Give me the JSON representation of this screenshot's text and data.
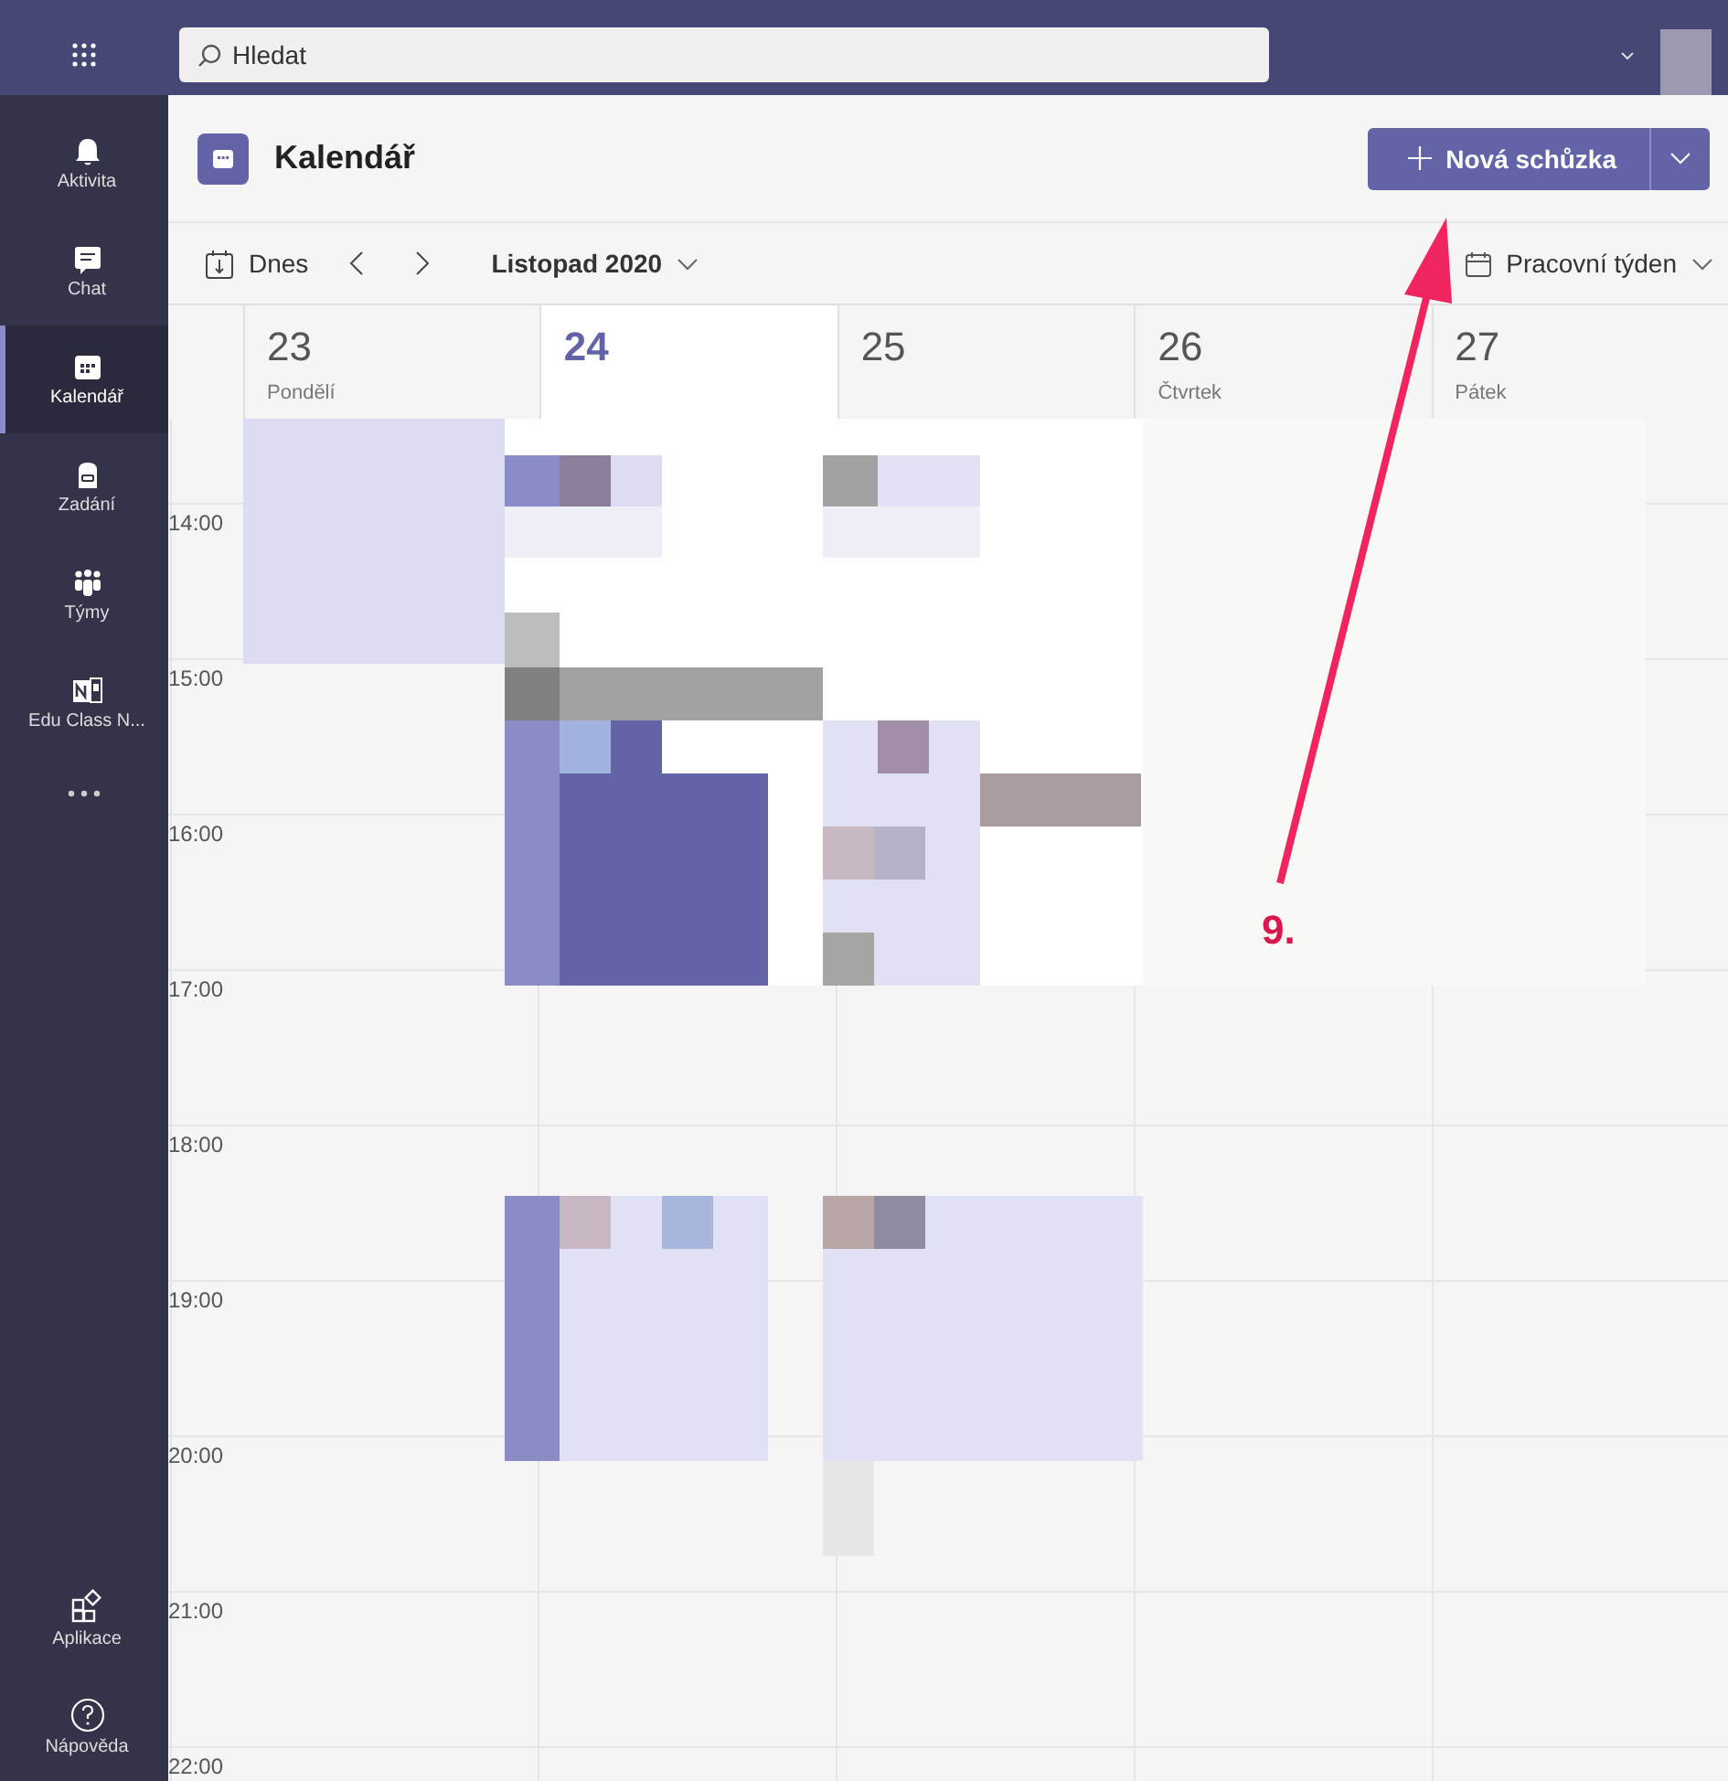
{
  "search": {
    "placeholder": "Hledat"
  },
  "rail": {
    "items": [
      {
        "label": "Aktivita",
        "kind": "bell",
        "selected": false
      },
      {
        "label": "Chat",
        "kind": "chat",
        "selected": false
      },
      {
        "label": "Kalendář",
        "kind": "calendar",
        "selected": true
      },
      {
        "label": "Zadání",
        "kind": "bag",
        "selected": false
      },
      {
        "label": "Týmy",
        "kind": "teams",
        "selected": false
      },
      {
        "label": "Edu Class N...",
        "kind": "notebook",
        "selected": false
      }
    ],
    "bottom": [
      {
        "label": "Aplikace",
        "kind": "apps"
      },
      {
        "label": "Nápověda",
        "kind": "help"
      }
    ]
  },
  "header": {
    "title": "Kalendář",
    "new_meeting": "Nová schůzka"
  },
  "toolbar": {
    "today": "Dnes",
    "month": "Listopad 2020",
    "view": "Pracovní týden"
  },
  "days": [
    {
      "number": "23",
      "name": "Pondělí",
      "selected": false
    },
    {
      "number": "24",
      "selected": true
    },
    {
      "number": "25",
      "selected": false
    },
    {
      "number": "26",
      "name": "Čtvrtek",
      "selected": false
    },
    {
      "number": "27",
      "name": "Pátek",
      "selected": false
    }
  ],
  "hours": [
    "14:00",
    "15:00",
    "16:00",
    "17:00",
    "18:00",
    "19:00",
    "20:00",
    "21:00",
    "22:00"
  ],
  "annotation": {
    "label": "9."
  }
}
